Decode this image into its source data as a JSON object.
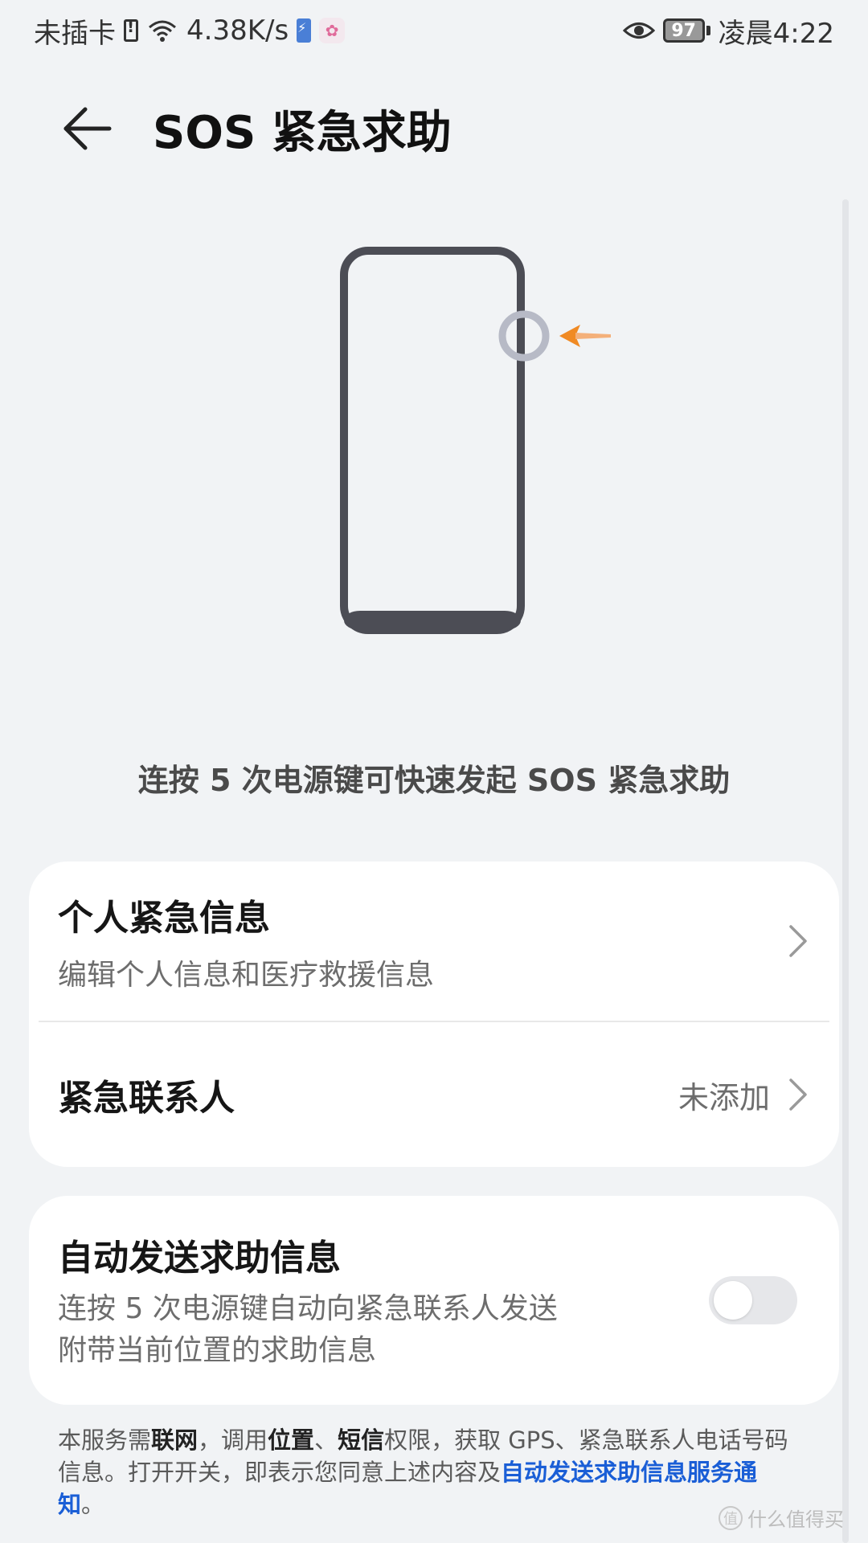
{
  "status_bar": {
    "carrier": "未插卡",
    "network_speed": "4.38K/s",
    "battery_level": "97",
    "time": "凌晨4:22",
    "icons": [
      "sim-alert-icon",
      "wifi-icon",
      "charging-icon",
      "app-notification-icon",
      "eye-comfort-icon",
      "battery-icon"
    ]
  },
  "header": {
    "title": "SOS 紧急求助",
    "back_icon": "back-arrow-icon"
  },
  "illustration": {
    "accent_color": "#f08a24"
  },
  "hint": "连按 5 次电源键可快速发起 SOS 紧急求助",
  "personal_info": {
    "title": "个人紧急信息",
    "subtitle": "编辑个人信息和医疗救援信息"
  },
  "emergency_contact": {
    "title": "紧急联系人",
    "value": "未添加"
  },
  "auto_send": {
    "title": "自动发送求助信息",
    "line1": "连按 5 次电源键自动向紧急联系人发送",
    "line2": "附带当前位置的求助信息",
    "enabled": false
  },
  "footer": {
    "part1": "本服务需",
    "bold1": "联网",
    "part2": "，调用",
    "bold2": "位置",
    "sep": "、",
    "bold3": "短信",
    "part3": "权限，获取 GPS、紧急联系人电话号码信息。打开开关，即表示您同意上述内容及",
    "link": "自动发送求助信息服务通知",
    "end": "。",
    "link_color": "#1a5ed6"
  },
  "watermark": {
    "badge": "值",
    "text": "什么值得买"
  }
}
